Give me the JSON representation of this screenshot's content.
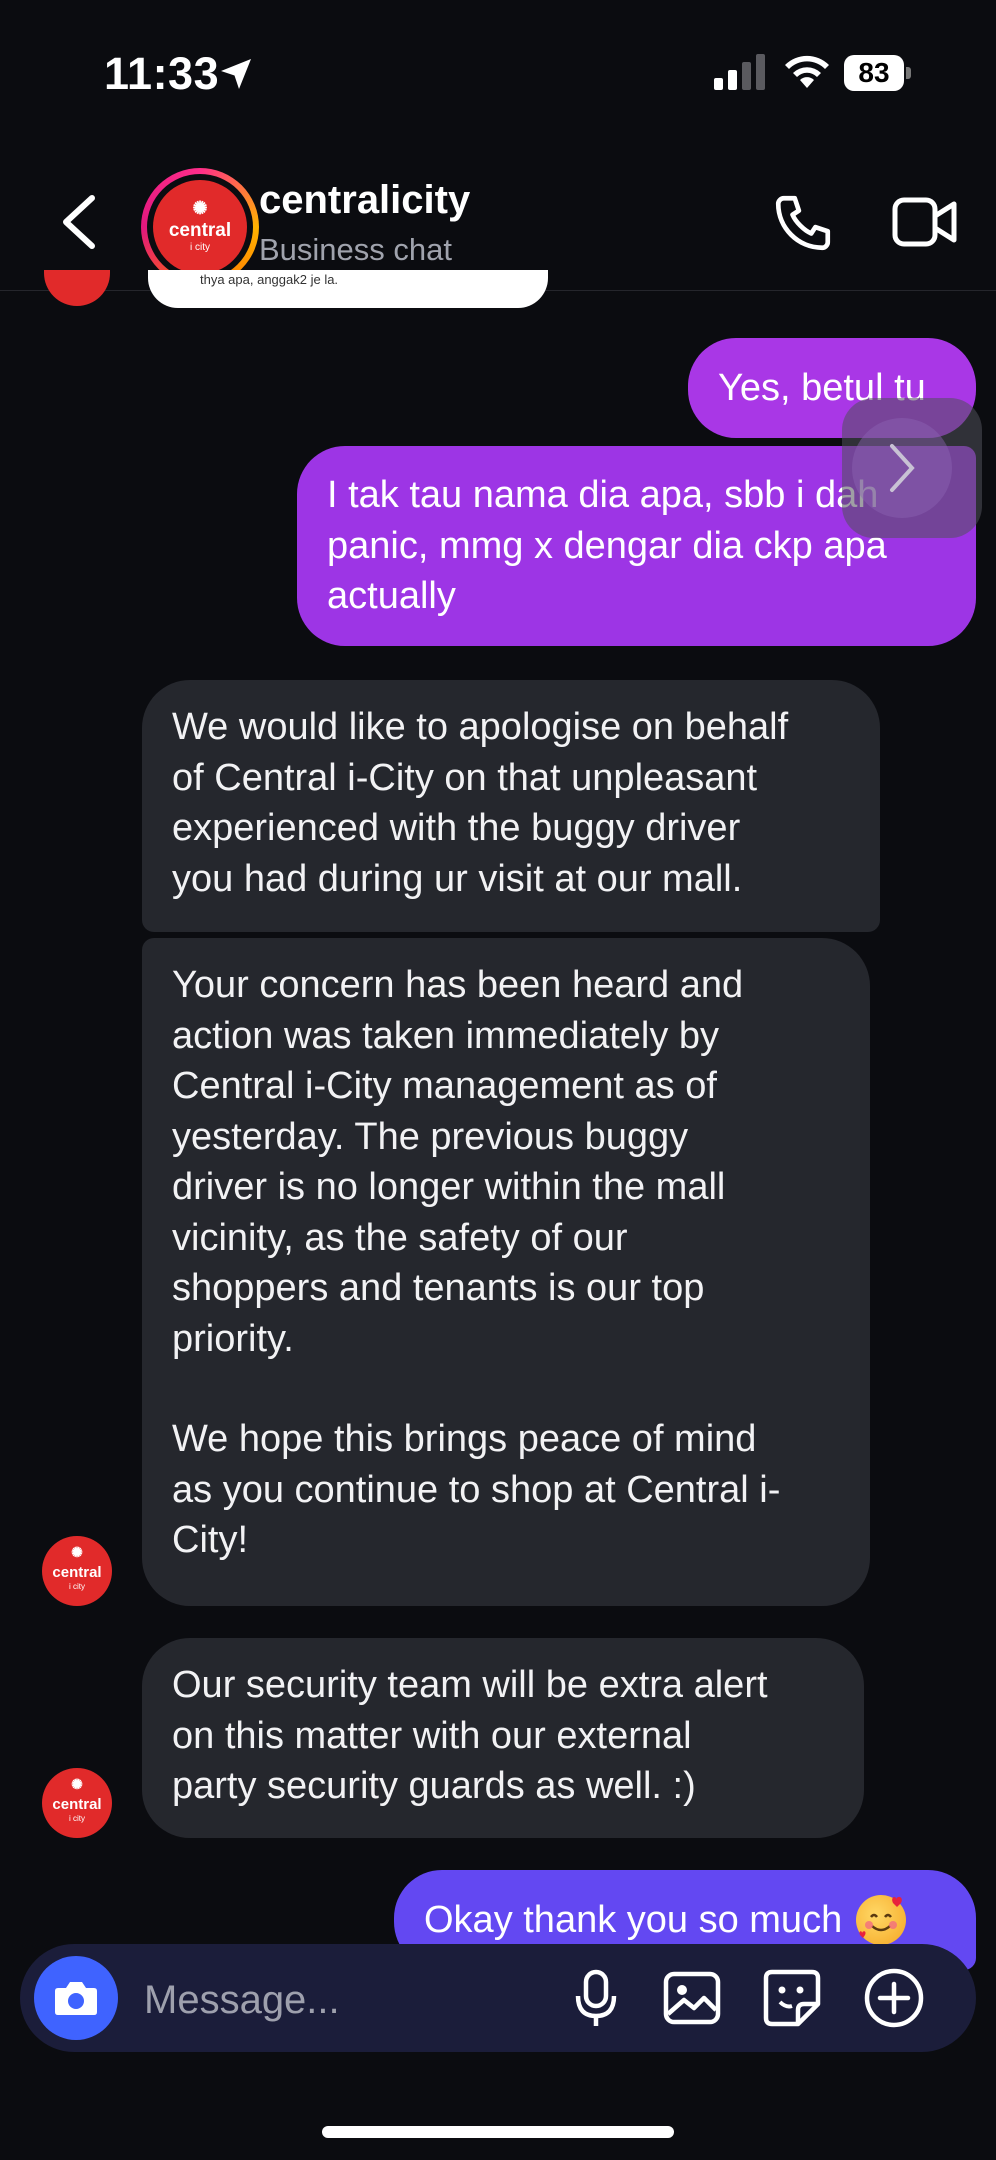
{
  "status": {
    "time": "11:33",
    "battery": "83"
  },
  "header": {
    "title": "centralicity",
    "subtitle": "Business chat",
    "logo_text": "central",
    "logo_sub": "i city"
  },
  "cutoff_text": "thya apa, anggak2 je la.",
  "messages": [
    {
      "dir": "out",
      "text": "Yes, betul tu"
    },
    {
      "dir": "out",
      "text": "I tak tau nama dia apa, sbb i dah\npanic, mmg x dengar dia ckp apa\nactually"
    },
    {
      "dir": "in",
      "text": "We would like to apologise on behalf\nof Central i-City on that unpleasant\nexperienced with the buggy driver\nyou had during ur visit at our mall."
    },
    {
      "dir": "in",
      "text_1": "Your concern has been heard and\naction was taken immediately by\nCentral i-City management as of\nyesterday. The previous buggy\ndriver is no longer within the mall\nvicinity, as the safety of our\nshoppers and tenants is our top\npriority.",
      "text_2": "We hope this brings peace of mind\nas you continue to shop at Central i-\nCity!"
    },
    {
      "dir": "in",
      "text": "Our security team will be extra alert\non this matter with our external\nparty security guards as well. :)"
    },
    {
      "dir": "out",
      "text": "Okay thank you so much",
      "emoji": "smiling-face-with-hearts"
    }
  ],
  "composer": {
    "placeholder": "Message..."
  },
  "colors": {
    "out_bubble": "#a937e6",
    "out_bubble_last": "#6348f2",
    "in_bubble": "#25272d",
    "brand_red": "#e12a2a",
    "camera_button": "#3f63ff"
  }
}
